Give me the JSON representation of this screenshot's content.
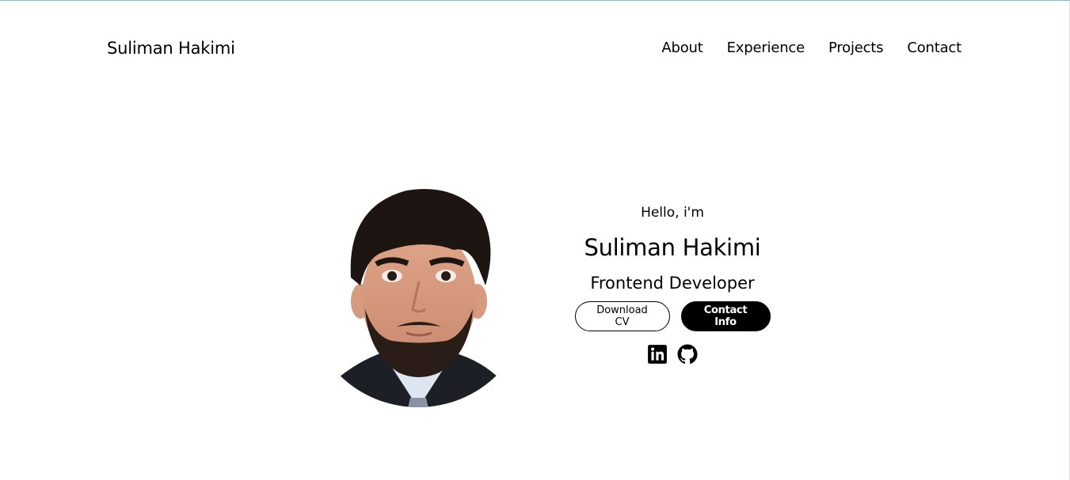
{
  "header": {
    "brand": "Suliman Hakimi",
    "nav": [
      "About",
      "Experience",
      "Projects",
      "Contact"
    ]
  },
  "hero": {
    "greeting": "Hello, i'm",
    "name": "Suliman Hakimi",
    "role": "Frontend Developer",
    "buttons": {
      "download": "Download CV",
      "contact": "Contact Info"
    },
    "socials": [
      "linkedin-icon",
      "github-icon"
    ]
  },
  "colors": {
    "accent": "#000000",
    "background": "#ffffff",
    "top_border": "#7fbfc6"
  }
}
